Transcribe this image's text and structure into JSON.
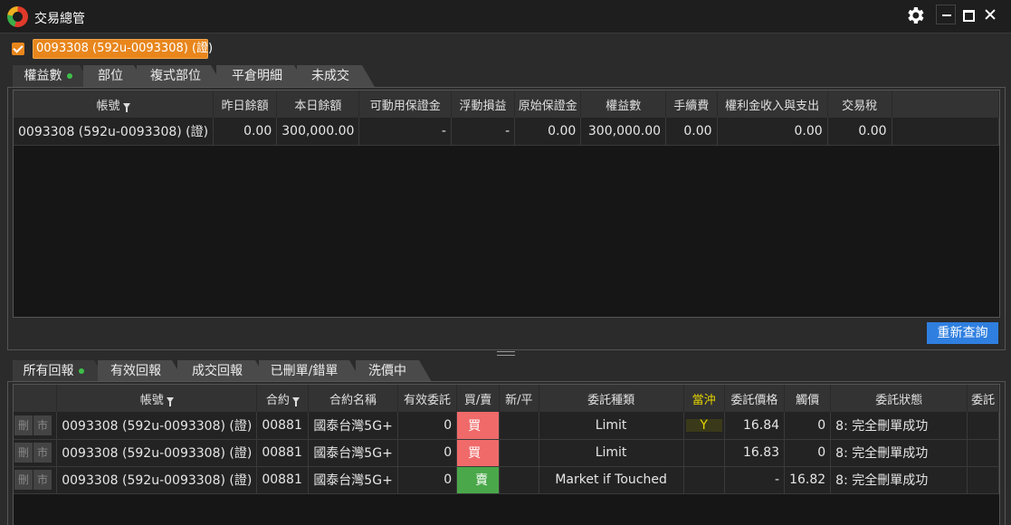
{
  "window": {
    "title": "交易總管",
    "icons": {
      "logo": "app-logo-icon",
      "settings": "gear-icon",
      "minimize": "minimize-icon",
      "maximize": "maximize-icon",
      "close": "close-icon"
    }
  },
  "account_selector": {
    "checked": true,
    "label": "0093308 (592u-0093308) (證)"
  },
  "top_tabs": [
    {
      "label": "權益數",
      "active": true,
      "indicator": true
    },
    {
      "label": "部位"
    },
    {
      "label": "複式部位"
    },
    {
      "label": "平倉明細"
    },
    {
      "label": "未成交"
    }
  ],
  "equity_table": {
    "headers": [
      "帳號",
      "昨日餘額",
      "本日餘額",
      "可動用保證金",
      "浮動損益",
      "原始保證金",
      "權益數",
      "手續費",
      "權利金收入與支出",
      "交易稅"
    ],
    "rows": [
      [
        "0093308 (592u-0093308) (證)",
        "0.00",
        "300,000.00",
        "-",
        "-",
        "0.00",
        "300,000.00",
        "0.00",
        "0.00",
        "0.00"
      ]
    ]
  },
  "requery_button": "重新查詢",
  "bottom_tabs": [
    {
      "label": "所有回報",
      "active": true,
      "indicator": true
    },
    {
      "label": "有效回報"
    },
    {
      "label": "成交回報"
    },
    {
      "label": "已刪單/錯單"
    },
    {
      "label": "洗價中"
    }
  ],
  "order_table": {
    "row_buttons": [
      "刪",
      "市"
    ],
    "headers": [
      "帳號",
      "合約",
      "合約名稱",
      "有效委託",
      "買/賣",
      "新/平",
      "委託種類",
      "當沖",
      "委託價格",
      "觸價",
      "委託狀態",
      "委託"
    ],
    "rows": [
      {
        "account": "0093308 (592u-0093308) (證)",
        "contract": "00881",
        "name": "國泰台灣5G+",
        "valid": "0",
        "side": "買",
        "side_type": "buy",
        "open_close": "",
        "order_type": "Limit",
        "day_trade": "Y",
        "price": "16.84",
        "trigger": "0",
        "status": "8: 完全刪單成功"
      },
      {
        "account": "0093308 (592u-0093308) (證)",
        "contract": "00881",
        "name": "國泰台灣5G+",
        "valid": "0",
        "side": "買",
        "side_type": "buy",
        "open_close": "",
        "order_type": "Limit",
        "day_trade": "",
        "price": "16.83",
        "trigger": "0",
        "status": "8: 完全刪單成功"
      },
      {
        "account": "0093308 (592u-0093308) (證)",
        "contract": "00881",
        "name": "國泰台灣5G+",
        "valid": "0",
        "side": "賣",
        "side_type": "sell",
        "open_close": "",
        "order_type": "Market if Touched",
        "day_trade": "",
        "price": "-",
        "trigger": "16.82",
        "status": "8: 完全刪單成功"
      }
    ]
  },
  "colors": {
    "accent": "#e8861c",
    "buy": "#f06a6a",
    "sell": "#4aa84a",
    "button": "#2f7fe0",
    "day_trade": "#e6d400"
  }
}
